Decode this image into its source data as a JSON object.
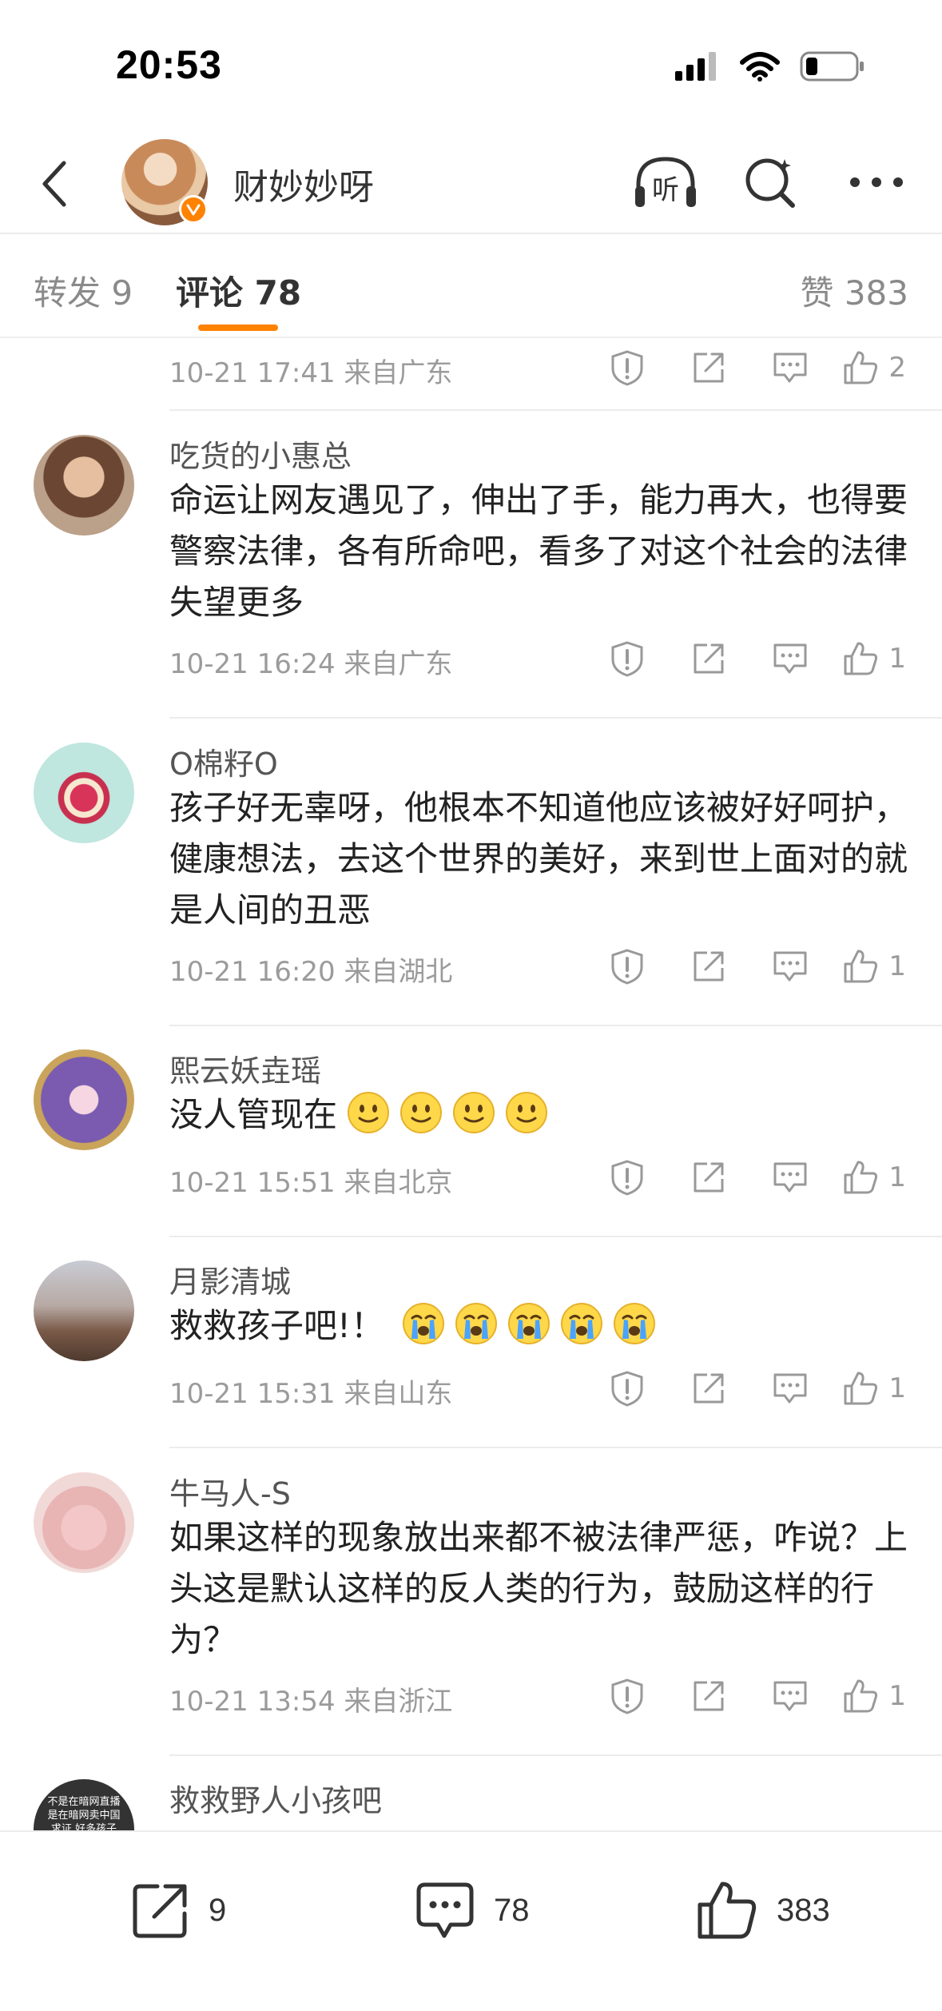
{
  "status_bar": {
    "time": "20:53",
    "icons": [
      "cellular-signal-icon",
      "wifi-icon",
      "battery-icon"
    ]
  },
  "header": {
    "name": "财妙妙呀",
    "actions": [
      "listen-icon",
      "search-icon",
      "more-icon"
    ],
    "listen_label": "听"
  },
  "tabs": {
    "repost": "转发 9",
    "comment": "评论 78",
    "likes": "赞 383",
    "accent": "#ff8200"
  },
  "top_meta": {
    "time": "10-21 17:41 来自广东",
    "likes": "2"
  },
  "comments": [
    {
      "user": "吃货的小惠总",
      "text": "命运让网友遇见了，伸出了手，能力再大，也得要警察法律，各有所命吧，看多了对这个社会的法律失望更多",
      "time": "10-21 16:24 来自广东",
      "likes": "1"
    },
    {
      "user": "O棉籽O",
      "text": "孩子好无辜呀，他根本不知道他应该被好好呵护，健康想法，去这个世界的美好，来到世上面对的就是人间的丑恶",
      "time": "10-21 16:20 来自湖北",
      "likes": "1"
    },
    {
      "user": "熙云妖垚瑶",
      "text": "没人管现在",
      "time": "10-21 15:51 来自北京",
      "likes": "1",
      "emoji": "slight-smile-emoji"
    },
    {
      "user": "月影清城",
      "text": "救救孩子吧!！",
      "time": "10-21 15:31 来自山东",
      "likes": "1",
      "emoji": "crying-emoji"
    },
    {
      "user": "牛马人-S",
      "text": "如果这样的现象放出来都不被法律严惩，咋说？上头这是默认这样的反人类的行为，鼓励这样的行为？",
      "time": "10-21 13:54 来自浙江",
      "likes": "1"
    },
    {
      "user": "救救野人小孩吧",
      "avatar_text": "不是在暗网直播 是在暗网卖中国 求证 好多孩子"
    }
  ],
  "bottom_bar": {
    "repost_count": "9",
    "comment_count": "78",
    "like_count": "383"
  }
}
